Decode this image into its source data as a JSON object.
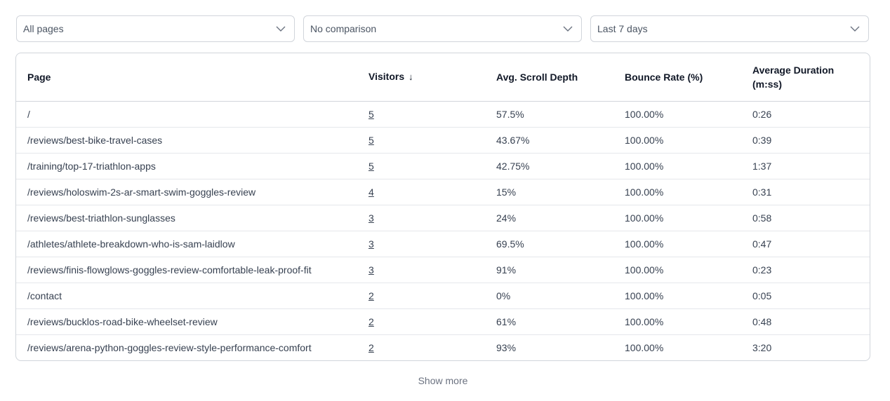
{
  "filters": {
    "page_filter": "All pages",
    "comparison": "No comparison",
    "date_range": "Last 7 days"
  },
  "table": {
    "headers": {
      "page": "Page",
      "visitors": "Visitors",
      "sort_indicator": "↓",
      "scroll_depth": "Avg. Scroll Depth",
      "bounce_rate": "Bounce Rate (%)",
      "avg_duration": "Average Duration (m:ss)"
    },
    "rows": [
      {
        "page": "/",
        "visitors": "5",
        "scroll_depth": "57.5%",
        "bounce_rate": "100.00%",
        "duration": "0:26"
      },
      {
        "page": "/reviews/best-bike-travel-cases",
        "visitors": "5",
        "scroll_depth": "43.67%",
        "bounce_rate": "100.00%",
        "duration": "0:39"
      },
      {
        "page": "/training/top-17-triathlon-apps",
        "visitors": "5",
        "scroll_depth": "42.75%",
        "bounce_rate": "100.00%",
        "duration": "1:37"
      },
      {
        "page": "/reviews/holoswim-2s-ar-smart-swim-goggles-review",
        "visitors": "4",
        "scroll_depth": "15%",
        "bounce_rate": "100.00%",
        "duration": "0:31"
      },
      {
        "page": "/reviews/best-triathlon-sunglasses",
        "visitors": "3",
        "scroll_depth": "24%",
        "bounce_rate": "100.00%",
        "duration": "0:58"
      },
      {
        "page": "/athletes/athlete-breakdown-who-is-sam-laidlow",
        "visitors": "3",
        "scroll_depth": "69.5%",
        "bounce_rate": "100.00%",
        "duration": "0:47"
      },
      {
        "page": "/reviews/finis-flowglows-goggles-review-comfortable-leak-proof-fit",
        "visitors": "3",
        "scroll_depth": "91%",
        "bounce_rate": "100.00%",
        "duration": "0:23"
      },
      {
        "page": "/contact",
        "visitors": "2",
        "scroll_depth": "0%",
        "bounce_rate": "100.00%",
        "duration": "0:05"
      },
      {
        "page": "/reviews/bucklos-road-bike-wheelset-review",
        "visitors": "2",
        "scroll_depth": "61%",
        "bounce_rate": "100.00%",
        "duration": "0:48"
      },
      {
        "page": "/reviews/arena-python-goggles-review-style-performance-comfort",
        "visitors": "2",
        "scroll_depth": "93%",
        "bounce_rate": "100.00%",
        "duration": "3:20"
      }
    ]
  },
  "footer": {
    "show_more": "Show more"
  }
}
